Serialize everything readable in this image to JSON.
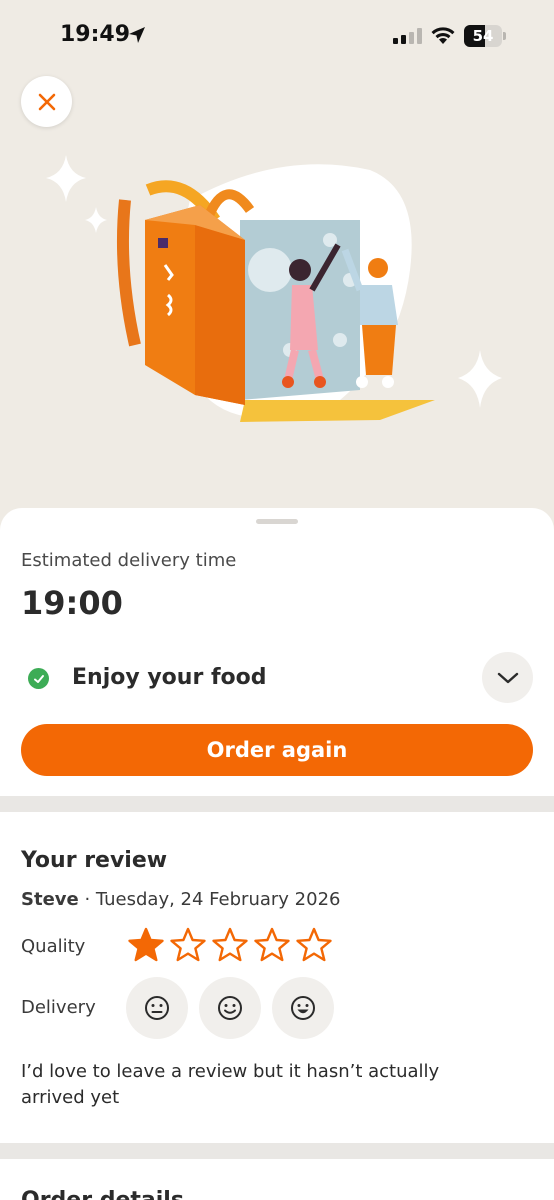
{
  "status_bar": {
    "time": "19:49",
    "battery": "54",
    "battery_fraction": 0.54
  },
  "icons": {
    "close": "close-icon",
    "location": "location-arrow-icon",
    "wifi": "wifi-icon",
    "chevron": "chevron-down-icon",
    "check": "check-icon"
  },
  "colors": {
    "accent": "#f36805",
    "success": "#3dac56",
    "hero_bg": "#efebe4"
  },
  "delivery": {
    "estimated_label": "Estimated delivery time",
    "estimated_time": "19:00",
    "status_text": "Enjoy your food",
    "order_again_label": "Order again"
  },
  "review": {
    "title": "Your review",
    "author": "Steve",
    "date": " · Tuesday, 24 February 2026",
    "quality_label": "Quality",
    "quality_rating": 1,
    "quality_max": 5,
    "delivery_label": "Delivery",
    "delivery_faces": [
      "neutral-face-icon",
      "smile-face-icon",
      "grin-face-icon"
    ],
    "text": "I’d love to leave a review but it hasn’t actually arrived yet"
  },
  "next_section": {
    "title": "Order details"
  }
}
